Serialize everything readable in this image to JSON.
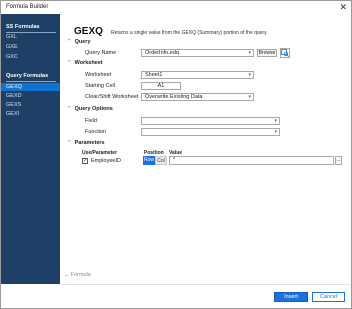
{
  "window": {
    "title": "Formula Builder",
    "close": "✕"
  },
  "sidebar": {
    "ss_header": "SS Formulas",
    "ss_items": [
      "GXL",
      "GXE",
      "GXC"
    ],
    "query_header": "Query Formulas",
    "query_items": [
      "GEXQ",
      "GEXD",
      "GEXS",
      "GEXI"
    ],
    "selected": "GEXQ"
  },
  "header": {
    "title": "GEXQ",
    "description": "Returns a single value from the GEXQ (Summary) portion of the query."
  },
  "query_section": {
    "title": "Query",
    "query_name_label": "Query Name",
    "query_name_value": "OrderInfo.edq",
    "browse_label": "Browse"
  },
  "worksheet_section": {
    "title": "Worksheet",
    "worksheet_label": "Worksheet",
    "worksheet_value": "Sheet1",
    "starting_cell_label": "Starting Cell",
    "starting_cell_value": "A1",
    "clear_label": "Clear/Shift Worksheet",
    "clear_value": "Overwrite Existing Data"
  },
  "query_options_section": {
    "title": "Query Options",
    "field_label": "Field",
    "field_value": "",
    "function_label": "Function",
    "function_value": ""
  },
  "parameters_section": {
    "title": "Parameters",
    "col_use_parameter": "Use/Parameter",
    "col_position": "Position",
    "col_value": "Value",
    "rows": [
      {
        "checked": true,
        "name": "EmployeeID",
        "position_row": "Row",
        "position_col": "Col",
        "value": "*",
        "more": "..."
      }
    ]
  },
  "formula_toggle": "Formula",
  "footer": {
    "insert_label": "Insert",
    "cancel_label": "Cancel"
  },
  "colors": {
    "sidebar_bg": "#1e3f66",
    "selected_bg": "#0f74d0",
    "accent": "#1a73d9"
  }
}
